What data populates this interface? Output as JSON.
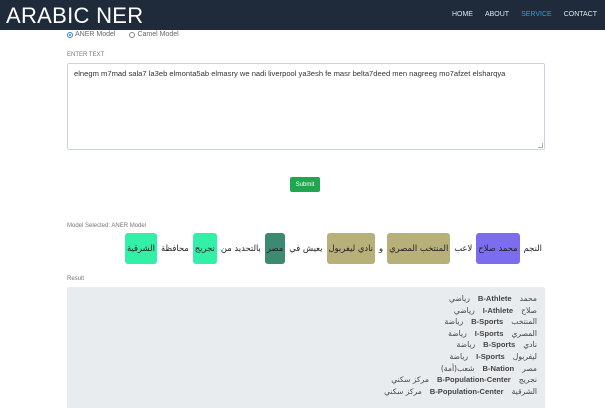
{
  "app": {
    "title": "ARABIC NER",
    "nav": [
      "HOME",
      "ABOUT",
      "SERVICE",
      "CONTACT"
    ],
    "active_nav": "SERVICE"
  },
  "model_options": {
    "aner_label": "ANER Model",
    "camel_label": "Camel Model",
    "selected": "ANER Model"
  },
  "input": {
    "label": "ENTER TEXT",
    "value": "elnegm m7mad sala7 la3eb elmonta5ab elmasry we nadi liverpool ya3esh fe masr belta7deed men nagreeg  mo7afzet elsharqya"
  },
  "submit_label": "Submit",
  "model_selected_text": "Model Selected: ANER Model",
  "ner_output": [
    {
      "text": "النجم",
      "color": ""
    },
    {
      "text": "محمد صلاح",
      "color": "#7b6cf0"
    },
    {
      "text": "لاعب",
      "color": ""
    },
    {
      "text": "المنتخب المصري",
      "color": "#b8b079"
    },
    {
      "text": "و",
      "color": ""
    },
    {
      "text": "نادي ليفربول",
      "color": "#b8b079"
    },
    {
      "text": "يعيش في",
      "color": ""
    },
    {
      "text": "مصر",
      "color": "#3d8a73"
    },
    {
      "text": "بالتحديد من",
      "color": ""
    },
    {
      "text": "نجريج",
      "color": "#32f0a8"
    },
    {
      "text": "محافظة",
      "color": ""
    },
    {
      "text": "الشرقية",
      "color": "#32f0a8"
    }
  ],
  "result": {
    "label": "Result",
    "rows": [
      {
        "word": "محمد",
        "tag": "B-Athlete",
        "cat": "رياضي"
      },
      {
        "word": "صلاح",
        "tag": "I-Athlete",
        "cat": "رياضي"
      },
      {
        "word": "المنتخب",
        "tag": "B-Sports",
        "cat": "رياضة"
      },
      {
        "word": "المصري",
        "tag": "I-Sports",
        "cat": "رياضة"
      },
      {
        "word": "نادي",
        "tag": "B-Sports",
        "cat": "رياضة"
      },
      {
        "word": "ليفربول",
        "tag": "I-Sports",
        "cat": "رياضة"
      },
      {
        "word": "مصر",
        "tag": "B-Nation",
        "cat": "شعب(أمة)"
      },
      {
        "word": "نجريج",
        "tag": "B-Population-Center",
        "cat": "مركز سكني"
      },
      {
        "word": "الشرقية",
        "tag": "B-Population-Center",
        "cat": "مركز سكني"
      }
    ]
  }
}
